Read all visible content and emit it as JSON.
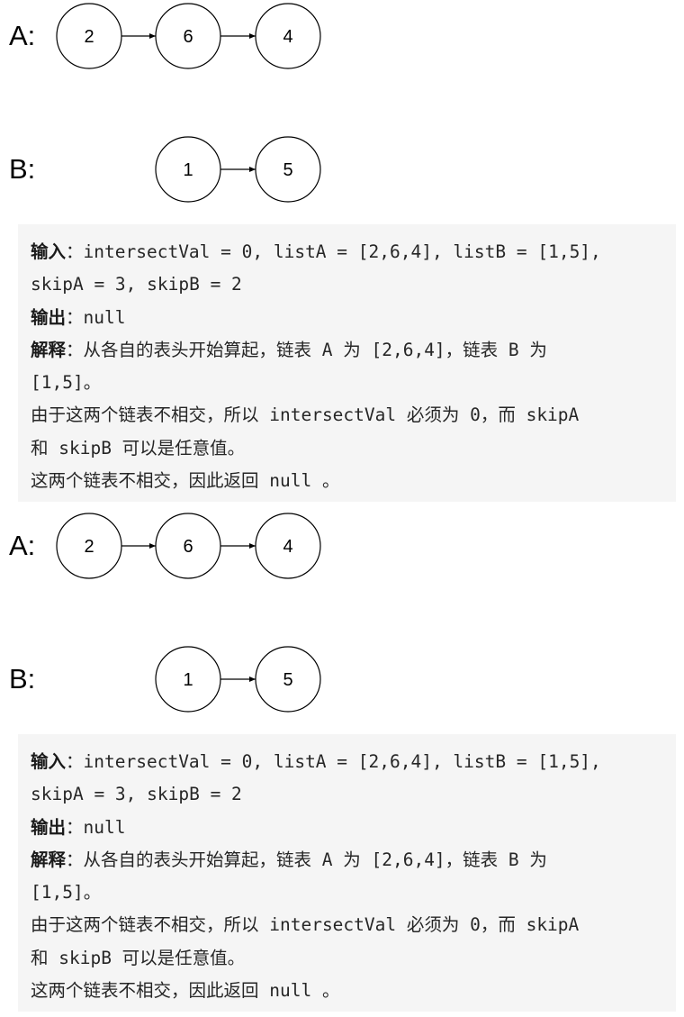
{
  "sections": [
    {
      "diagram": {
        "list_a_label": "A:",
        "list_b_label": "B:",
        "list_a_nodes": [
          "2",
          "6",
          "4"
        ],
        "list_b_nodes": [
          "1",
          "5"
        ]
      },
      "example": {
        "input_label": "输入",
        "input_colon": "：",
        "input_line1": "intersectVal = 0, listA = [2,6,4], listB = [1,5],",
        "input_line2": "skipA = 3, skipB = 2",
        "output_label": "输出",
        "output_colon": "：",
        "output_value": "null",
        "explain_label": "解释",
        "explain_colon": "：",
        "explain_line1": "从各自的表头开始算起，链表 A 为 [2,6,4]，链表 B 为",
        "explain_line2": "[1,5]。",
        "explain_line3": "由于这两个链表不相交，所以 intersectVal 必须为 0，而 skipA",
        "explain_line4": "和 skipB 可以是任意值。",
        "explain_line5": "这两个链表不相交，因此返回 null 。"
      }
    },
    {
      "diagram": {
        "list_a_label": "A:",
        "list_b_label": "B:",
        "list_a_nodes": [
          "2",
          "6",
          "4"
        ],
        "list_b_nodes": [
          "1",
          "5"
        ]
      },
      "example": {
        "input_label": "输入",
        "input_colon": "：",
        "input_line1": "intersectVal = 0, listA = [2,6,4], listB = [1,5],",
        "input_line2": "skipA = 3, skipB = 2",
        "output_label": "输出",
        "output_colon": "：",
        "output_value": "null",
        "explain_label": "解释",
        "explain_colon": "：",
        "explain_line1": "从各自的表头开始算起，链表 A 为 [2,6,4]，链表 B 为",
        "explain_line2": "[1,5]。",
        "explain_line3": "由于这两个链表不相交，所以 intersectVal 必须为 0，而 skipA",
        "explain_line4": "和 skipB 可以是任意值。",
        "explain_line5": "这两个链表不相交，因此返回 null 。"
      }
    }
  ]
}
